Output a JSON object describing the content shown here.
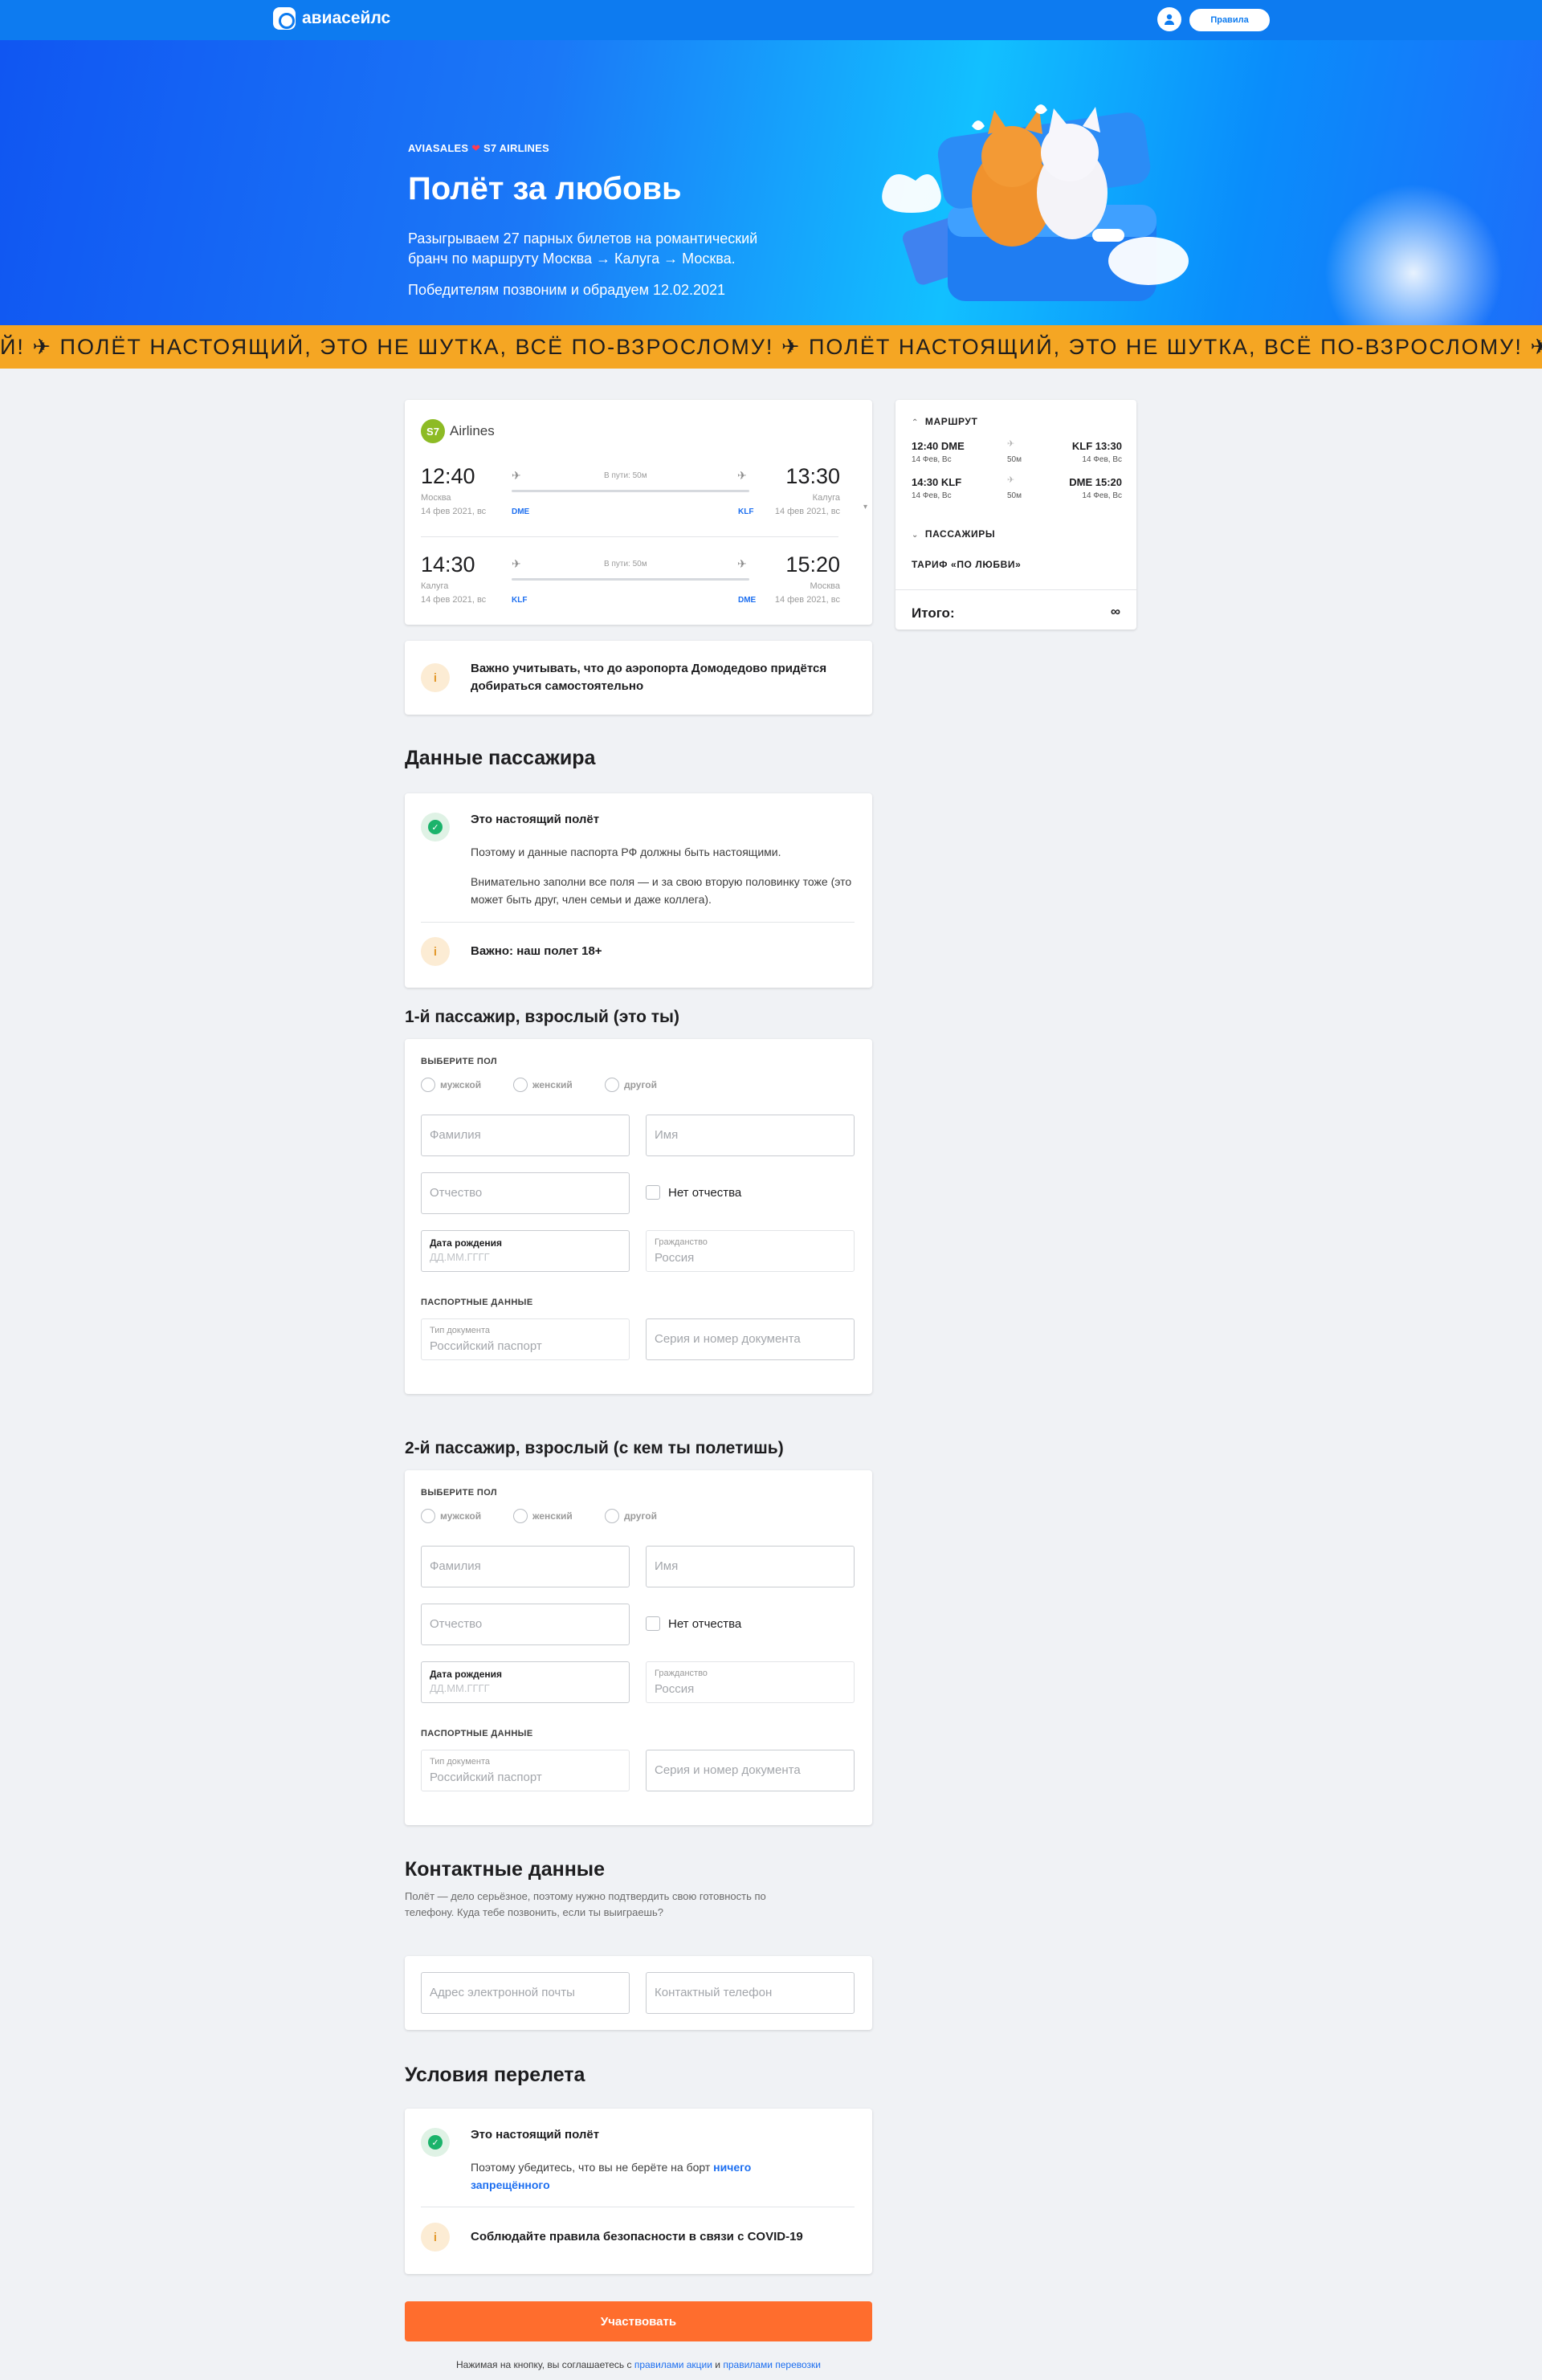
{
  "header": {
    "logo_text": "авиасейлс",
    "rules_button": "Правила"
  },
  "hero": {
    "kicker_left": "AVIASALES",
    "kicker_right": "S7 AIRLINES",
    "title": "Полёт за любовь",
    "text": "Разыгрываем 27 парных билетов на романтический бранч по маршруту Москва → Калуга → Москва.",
    "date_text": "Победителям позвоним и обрадуем 12.02.2021"
  },
  "ticker": {
    "text": "Й!  ✈  ПОЛЁТ НАСТОЯЩИЙ, ЭТО НЕ ШУТКА, ВСЁ ПО-ВЗРОСЛОМУ!  ✈  ПОЛЁТ НАСТОЯЩИЙ, ЭТО НЕ ШУТКА, ВСЁ ПО-ВЗРОСЛОМУ!  ✈  ПОЛ"
  },
  "flight": {
    "airline_badge": "S7",
    "airline": "Airlines",
    "segments": [
      {
        "dep_time": "12:40",
        "dep_city": "Москва",
        "dep_date": "14 фев 2021, вс",
        "dep_code": "DME",
        "duration": "В пути: 50м",
        "arr_time": "13:30",
        "arr_city": "Калуга",
        "arr_date": "14 фев 2021, вс",
        "arr_code": "KLF"
      },
      {
        "dep_time": "14:30",
        "dep_city": "Калуга",
        "dep_date": "14 фев 2021, вс",
        "dep_code": "KLF",
        "duration": "В пути: 50м",
        "arr_time": "15:20",
        "arr_city": "Москва",
        "arr_date": "14 фев 2021, вс",
        "arr_code": "DME"
      }
    ]
  },
  "notice": {
    "text": "Важно учитывать, что до аэропорта Домодедово придётся добираться самостоятельно"
  },
  "passenger_section": {
    "title": "Данные пассажира",
    "real_title": "Это настоящий полёт",
    "real_p1": "Поэтому и данные паспорта РФ должны быть настоящими.",
    "real_p2": "Внимательно заполни все поля — и за свою вторую половинку тоже (это может быть друг, член семьи и даже коллега).",
    "age_notice": "Важно: наш полет 18+"
  },
  "passengers": [
    {
      "title": "1-й пассажир, взрослый (это ты)"
    },
    {
      "title": "2-й пассажир, взрослый (с кем ты полетишь)"
    }
  ],
  "form": {
    "gender_label": "Выберите пол",
    "gender_options": [
      "мужской",
      "женский",
      "другой"
    ],
    "lastname": "Фамилия",
    "firstname": "Имя",
    "middlename": "Отчество",
    "no_middlename": "Нет отчества",
    "birth_label": "Дата рождения",
    "birth_placeholder": "ДД.ММ.ГГГГ",
    "citizenship_label": "Гражданство",
    "citizenship_value": "Россия",
    "passport_label": "Паспортные данные",
    "doc_type_label": "Тип документа",
    "doc_type_value": "Российский паспорт",
    "doc_number": "Серия и номер документа"
  },
  "contacts": {
    "title": "Контактные данные",
    "text": "Полёт — дело серьёзное, поэтому нужно подтвердить свою готовность по телефону. Куда тебе позвонить, если ты выиграешь?",
    "email": "Адрес электронной почты",
    "phone": "Контактный телефон"
  },
  "conditions": {
    "title": "Условия перелета",
    "real_title": "Это настоящий полёт",
    "text": "Поэтому убедитесь, что вы не берёте на борт",
    "link": "ничего запрещённого",
    "covid": "Соблюдайте правила безопасности в связи с COVID-19"
  },
  "submit": "Участвовать",
  "footer": {
    "text": "Нажимая на кнопку, вы соглашаетесь с",
    "link1": "правилами акции",
    "and": "и",
    "link2": "правилами перевозки"
  },
  "summary": {
    "route_title": "МАРШРУТ",
    "rows": [
      {
        "dep": "12:40 DME",
        "dep_date": "14 Фев, Вс",
        "dur": "50м",
        "arr": "KLF 13:30",
        "arr_date": "14 Фев, Вс"
      },
      {
        "dep": "14:30 KLF",
        "dep_date": "14 Фев, Вс",
        "dur": "50м",
        "arr": "DME 15:20",
        "arr_date": "14 Фев, Вс"
      }
    ],
    "passengers_title": "ПАССАЖИРЫ",
    "tariff": "ТАРИФ «ПО ЛЮБВИ»",
    "total_label": "Итого:",
    "total_value": "∞"
  },
  "colors": {
    "brand": "#0d7bf0",
    "ticker": "#f5a623",
    "submit": "#ff6d2d",
    "link": "#1d6ff0"
  }
}
